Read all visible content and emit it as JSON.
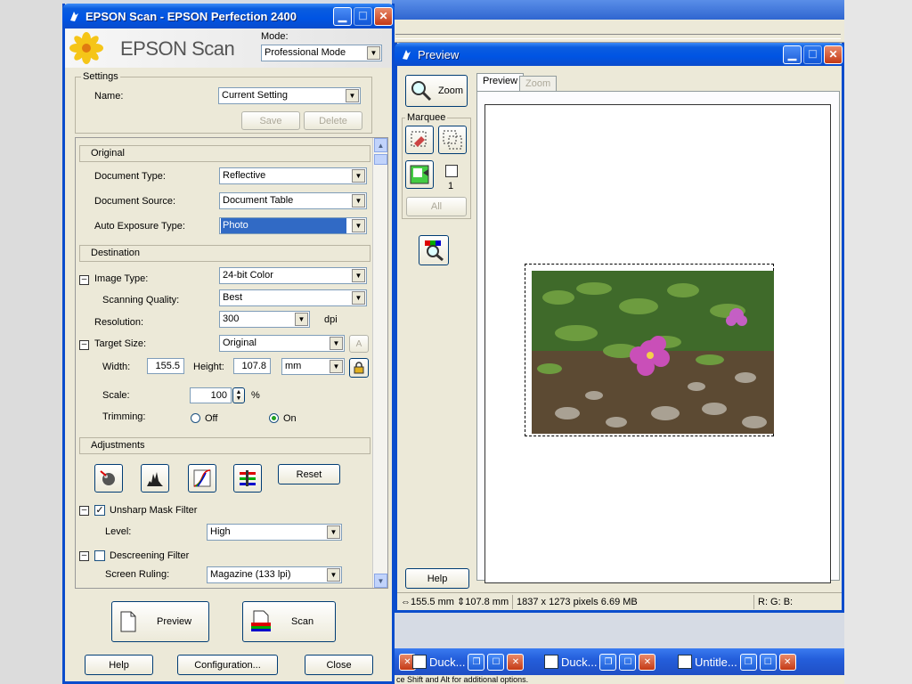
{
  "main_window": {
    "title": "EPSON Scan - EPSON Perfection 2400",
    "brand": "EPSON Scan",
    "mode_label": "Mode:",
    "mode_value": "Professional Mode",
    "settings": {
      "legend": "Settings",
      "name_label": "Name:",
      "name_value": "Current Setting",
      "save": "Save",
      "delete": "Delete"
    },
    "original": {
      "head": "Original",
      "doc_type_label": "Document Type:",
      "doc_type_value": "Reflective",
      "doc_source_label": "Document Source:",
      "doc_source_value": "Document Table",
      "auto_exposure_label": "Auto Exposure Type:",
      "auto_exposure_value": "Photo"
    },
    "destination": {
      "head": "Destination",
      "image_type_label": "Image Type:",
      "image_type_value": "24-bit Color",
      "scan_quality_label": "Scanning Quality:",
      "scan_quality_value": "Best",
      "resolution_label": "Resolution:",
      "resolution_value": "300",
      "resolution_unit": "dpi",
      "target_size_label": "Target Size:",
      "target_size_value": "Original",
      "width_label": "Width:",
      "width_value": "155.5",
      "height_label": "Height:",
      "height_value": "107.8",
      "unit_value": "mm",
      "scale_label": "Scale:",
      "scale_value": "100",
      "scale_unit": "%",
      "trimming_label": "Trimming:",
      "trim_off": "Off",
      "trim_on": "On"
    },
    "adjustments": {
      "head": "Adjustments",
      "reset": "Reset",
      "unsharp_label": "Unsharp Mask Filter",
      "level_label": "Level:",
      "level_value": "High",
      "descreen_label": "Descreening Filter",
      "screen_ruling_label": "Screen Ruling:",
      "screen_ruling_value": "Magazine (133 lpi)"
    },
    "buttons": {
      "preview": "Preview",
      "scan": "Scan",
      "help": "Help",
      "configuration": "Configuration...",
      "close": "Close"
    }
  },
  "preview_window": {
    "title": "Preview",
    "zoom_btn": "Zoom",
    "marquee_legend": "Marquee",
    "marquee_count": "1",
    "all_btn": "All",
    "tab_preview": "Preview",
    "tab_zoom": "Zoom",
    "help": "Help",
    "status_size": "155.5 mm",
    "status_size2": "107.8 mm",
    "status_pixels": "1837 x 1273 pixels 6.69 MB",
    "status_rgb": "R: G: B:"
  },
  "taskbar": {
    "items": [
      "Duck...",
      "Duck...",
      "Untitle..."
    ],
    "hint": "ce Shift and Alt for additional options."
  },
  "colors": {
    "titlebar": "#0054e3",
    "selection": "#316ac5",
    "window_bg": "#ece9d8"
  }
}
